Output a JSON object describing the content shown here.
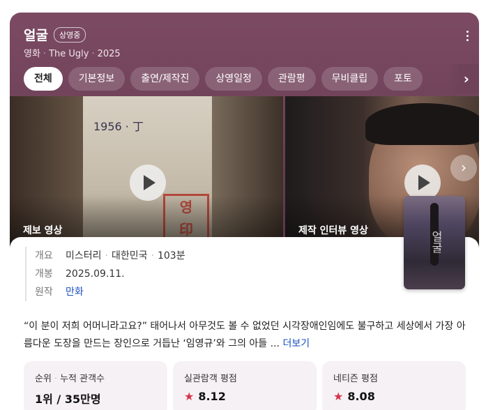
{
  "header": {
    "title": "얼굴",
    "badge": "상영중",
    "category": "영화",
    "english_title": "The Ugly",
    "year": "2025"
  },
  "tabs": [
    {
      "label": "전체",
      "active": true
    },
    {
      "label": "기본정보"
    },
    {
      "label": "출연/제작진"
    },
    {
      "label": "상영일정"
    },
    {
      "label": "관람평"
    },
    {
      "label": "무비클립"
    },
    {
      "label": "포토"
    }
  ],
  "videos": [
    {
      "label": "제보 영상"
    },
    {
      "label": "제작 인터뷰 영상"
    }
  ],
  "poster": {
    "title": "얼굴"
  },
  "meta": {
    "overview_key": "개요",
    "genre": "미스터리",
    "country": "대한민국",
    "runtime": "103분",
    "release_key": "개봉",
    "release_date": "2025.09.11.",
    "original_key": "원작",
    "original": "만화"
  },
  "synopsis": {
    "text": "“이 분이 저희 어머니라고요?” 태어나서 아무것도 볼 수 없었던 시각장애인임에도 불구하고 세상에서 가장 아름다운 도장을 만드는 장인으로 거듭난 ‘임영규’와 그의 아들 ...",
    "more": "더보기"
  },
  "stats": {
    "rank_label": "순위",
    "audience_label": "누적 관객수",
    "rank": "1위",
    "audience": "35만명",
    "viewer_rating_label": "실관람객 평점",
    "viewer_rating": "8.12",
    "netizen_rating_label": "네티즌 평점",
    "netizen_rating": "8.08"
  },
  "colors": {
    "hero_bg": "#6f4259",
    "link": "#1a4ec0",
    "star": "#d7334b"
  }
}
